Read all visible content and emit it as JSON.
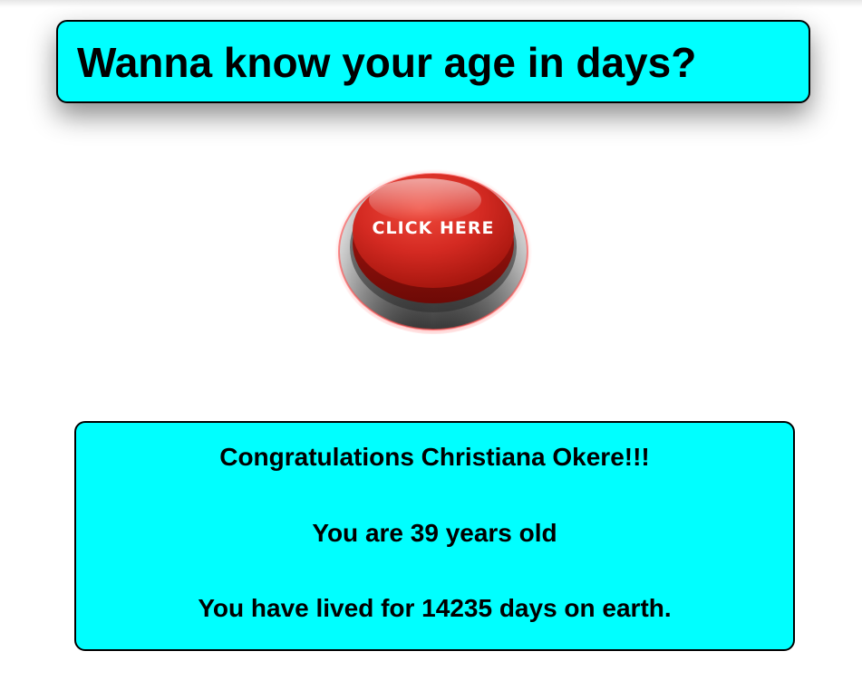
{
  "header": {
    "title": "Wanna know your age in days?"
  },
  "action_button": {
    "label": "CLICK HERE",
    "icon": "red-push-button"
  },
  "result": {
    "congratulations": "Congratulations Christiana Okere!!!",
    "age_years": "You are 39 years old",
    "age_days": "You have lived for 14235 days on earth."
  },
  "colors": {
    "card_background": "#00ffff",
    "card_border": "#000000",
    "button_red": "#d42a22"
  }
}
